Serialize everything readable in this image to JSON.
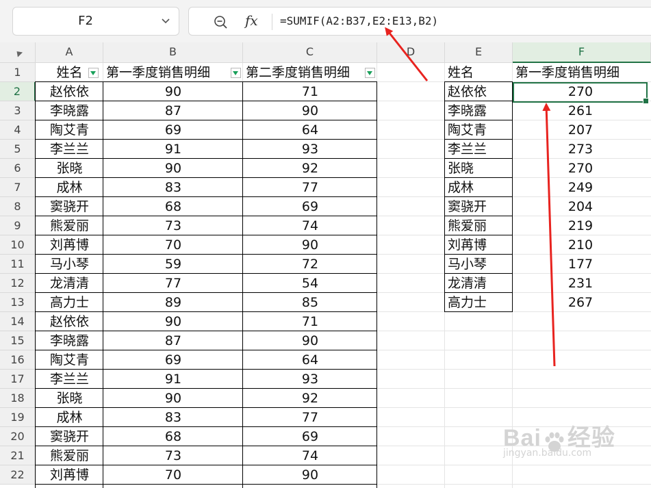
{
  "name_box": {
    "ref": "F2"
  },
  "formula_bar": {
    "formula": "=SUMIF(A2:B37,E2:E13,B2)"
  },
  "columns": [
    "A",
    "B",
    "C",
    "D",
    "E",
    "F"
  ],
  "rows": [
    "1",
    "2",
    "3",
    "4",
    "5",
    "6",
    "7",
    "8",
    "9",
    "10",
    "11",
    "12",
    "13",
    "14",
    "15",
    "16",
    "17",
    "18",
    "19",
    "20",
    "21",
    "22"
  ],
  "table1": {
    "headers": [
      "姓名",
      "第一季度销售明细",
      "第二季度销售明细"
    ],
    "names": [
      "赵依依",
      "李晓露",
      "陶艾青",
      "李兰兰",
      "张晓",
      "成林",
      "窦骁开",
      "熊爱丽",
      "刘苒博",
      "马小琴",
      "龙清清",
      "高力士",
      "赵依依",
      "李晓露",
      "陶艾青",
      "李兰兰",
      "张晓",
      "成林",
      "窦骁开",
      "熊爱丽",
      "刘苒博"
    ],
    "q1": [
      90,
      87,
      69,
      91,
      90,
      83,
      68,
      73,
      70,
      59,
      77,
      89,
      90,
      87,
      69,
      91,
      90,
      83,
      68,
      73,
      70
    ],
    "q2": [
      71,
      90,
      64,
      93,
      92,
      77,
      69,
      74,
      90,
      72,
      54,
      85,
      71,
      90,
      64,
      93,
      92,
      77,
      69,
      74,
      90
    ]
  },
  "table2": {
    "headers": [
      "姓名",
      "第一季度销售明细"
    ],
    "names": [
      "赵依依",
      "李晓露",
      "陶艾青",
      "李兰兰",
      "张晓",
      "成林",
      "窦骁开",
      "熊爱丽",
      "刘苒博",
      "马小琴",
      "龙清清",
      "高力士"
    ],
    "sums": [
      270,
      261,
      207,
      273,
      270,
      249,
      204,
      219,
      210,
      177,
      231,
      267
    ]
  },
  "watermark": {
    "logo_left": "Bai",
    "logo_right": "经验",
    "url": "jingyan.baidu.com"
  },
  "colors": {
    "accent": "#217346",
    "arrow": "#e8231f",
    "filter": "#19a05a"
  }
}
